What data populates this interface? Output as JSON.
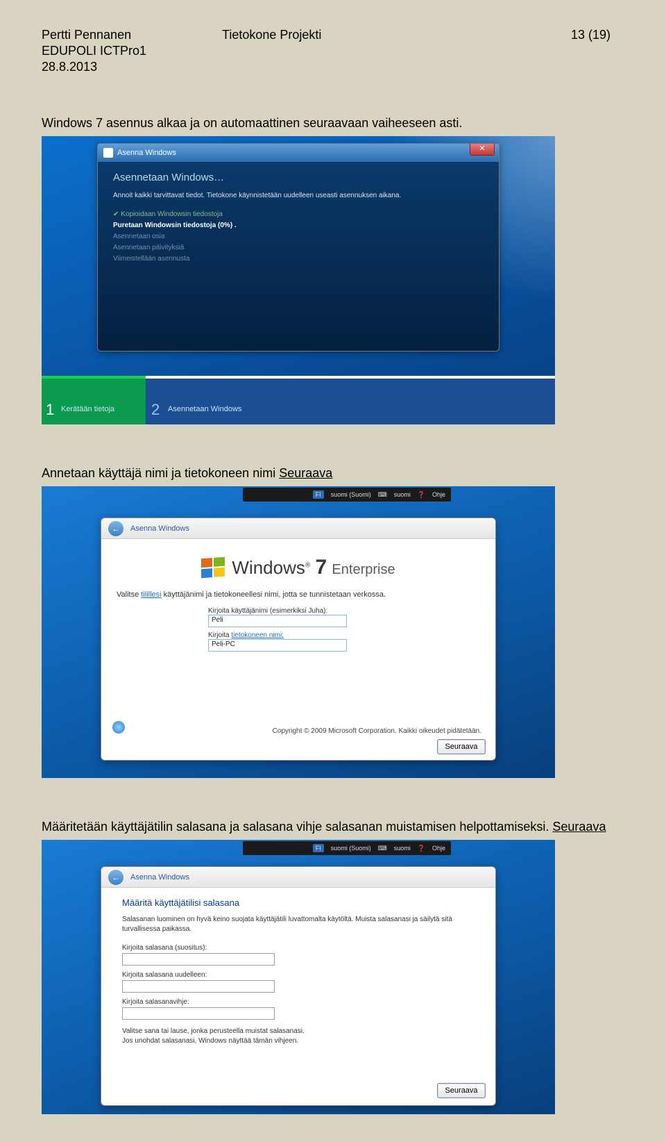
{
  "header": {
    "author": "Pertti Pennanen",
    "course": "EDUPOLI  ICTPro1",
    "date": "28.8.2013",
    "project": "Tietokone Projekti",
    "page": "13 (19)"
  },
  "text1": "Windows 7 asennus alkaa ja on automaattinen seuraavaan vaiheeseen asti.",
  "text2_a": "Annetaan käyttäjä nimi ja tietokoneen nimi ",
  "text2_b": "Seuraava",
  "text3_a": "Määritetään käyttäjätilin salasana ja salasana vihje salasanan muistamisen helpottamiseksi. ",
  "text3_b": "Seuraava",
  "shot1": {
    "title": "Asenna Windows",
    "close": "✕",
    "heading": "Asennetaan Windows…",
    "info": "Annoit kaikki tarvittavat tiedot. Tietokone käynnistetään uudelleen useasti asennuksen aikana.",
    "step1": "Kopioidaan Windowsin tiedostoja",
    "step2": "Puretaan Windowsin tiedostoja (0%) .",
    "step3": "Asennetaan osia",
    "step4": "Asennetaan päivityksiä",
    "step5": "Viimeistellään asennusta",
    "prog1": "Kerätään tietoja",
    "prog2": "Asennetaan Windows"
  },
  "shot2": {
    "lang_fi": "FI",
    "lang_label": "suomi (Suomi)",
    "lang_kb": "suomi",
    "lang_help": "Ohje",
    "title": "Asenna Windows",
    "logo_a": "Windows",
    "logo_b": "7",
    "logo_c": " Enterprise",
    "instr_a": "Valitse ",
    "instr_link": "tilillesi",
    "instr_b": " käyttäjänimi ja tietokoneellesi nimi, jotta se tunnistetaan verkossa.",
    "field1_label": "Kirjoita käyttäjänimi (esimerkiksi Juha):",
    "field1_value": "Peli",
    "field2_label_a": "Kirjoita ",
    "field2_link": "tietokoneen nimi:",
    "field2_value": "Peli-PC",
    "copyright": "Copyright © 2009 Microsoft Corporation. Kaikki oikeudet pidätetään.",
    "next": "Seuraava"
  },
  "shot3": {
    "lang_fi": "FI",
    "lang_label": "suomi (Suomi)",
    "lang_kb": "suomi",
    "lang_help": "Ohje",
    "title": "Asenna Windows",
    "heading": "Määritä käyttäjätilisi salasana",
    "note": "Salasanan luominen on hyvä keino suojata käyttäjätili luvattomalta käytöltä. Muista salasanasi ja säilytä sitä turvallisessa paikassa.",
    "field1": "Kirjoita salasana (suositus):",
    "field2": "Kirjoita salasana uudelleen:",
    "field3": "Kirjoita salasanavihje:",
    "hint": "Valitse sana tai lause, jonka perusteella muistat salasanasi.\nJos unohdat salasanasi, Windows näyttää tämän vihjeen.",
    "next": "Seuraava"
  }
}
